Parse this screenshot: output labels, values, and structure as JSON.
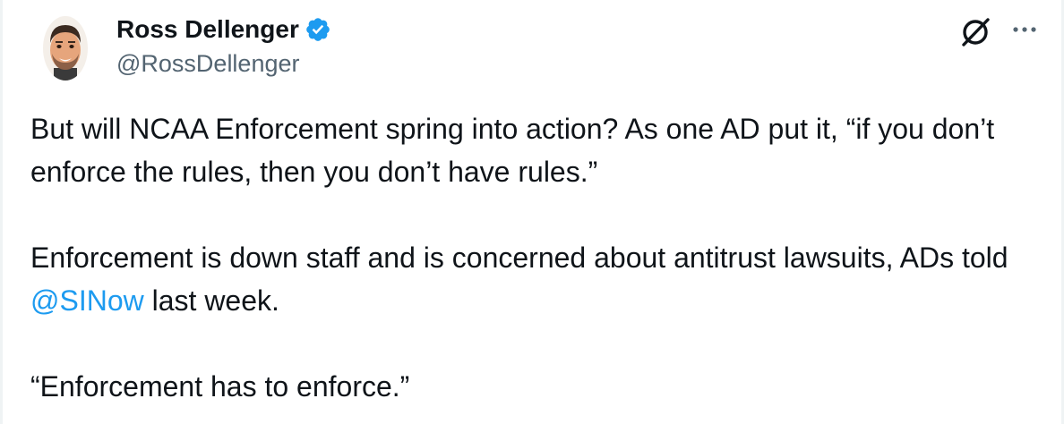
{
  "author": {
    "display_name": "Ross Dellenger",
    "handle": "@RossDellenger",
    "verified": true
  },
  "icons": {
    "verified": "verified-badge-icon",
    "grok": "grok-slash-icon",
    "more": "more-options-icon"
  },
  "colors": {
    "text": "#0f1419",
    "secondary": "#536471",
    "link": "#1d9bf0",
    "verified": "#1d9bf0"
  },
  "tweet": {
    "p1": "But will NCAA Enforcement spring into action? As one AD put it, “if you don’t enforce the rules, then you don’t have rules.”",
    "p2_before": "Enforcement is down staff and is concerned about antitrust lawsuits, ADs told ",
    "p2_mention": "@SINow",
    "p2_after": " last week.",
    "p3": "“Enforcement has to enforce.”"
  }
}
